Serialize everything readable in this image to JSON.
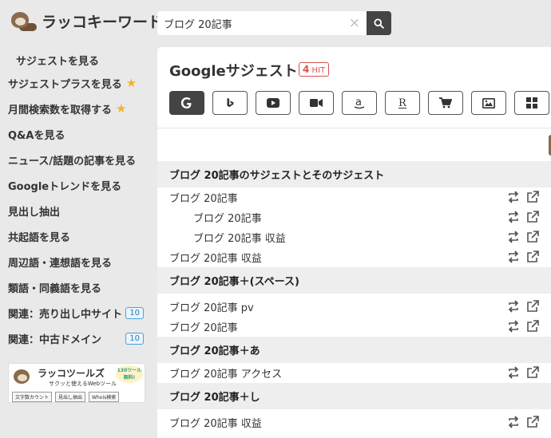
{
  "header": {
    "logo_text": "ラッコキーワード",
    "search_value": "ブログ 20記事",
    "clear_symbol": "×"
  },
  "sidebar": {
    "items": [
      {
        "label": "サジェストを見る"
      },
      {
        "label": "サジェストプラスを見る",
        "star": "★"
      },
      {
        "label": "月間検索数を取得する",
        "star": "★"
      },
      {
        "label": "Q&Aを見る"
      },
      {
        "label": "ニュース/話題の記事を見る"
      },
      {
        "label": "Googleトレンドを見る"
      },
      {
        "label": "見出し抽出"
      },
      {
        "label": "共起語を見る"
      },
      {
        "label": "周辺語・連想語を見る"
      },
      {
        "label": "類語・同義語を見る"
      },
      {
        "label": "関連：売り出し中サイト",
        "badge": "10"
      },
      {
        "label": "関連：中古ドメイン",
        "badge": "10"
      }
    ],
    "ad": {
      "title": "ラッコツールズ",
      "subtitle": "サクッと使えるWebツール",
      "free_line1": "130ツール",
      "free_line2": "無料!",
      "tags": [
        "文字数カウント",
        "見出し抽出",
        "Whois検索"
      ]
    }
  },
  "main": {
    "title": "Googleサジェスト",
    "hit_count": "4",
    "hit_label": "HIT",
    "engines": [
      "google-icon",
      "bing-icon",
      "youtube-icon",
      "video-icon",
      "amazon-icon",
      "rakuten-icon",
      "cart-icon",
      "image-icon",
      "grid-icon"
    ],
    "sections": [
      {
        "heading": "ブログ 20記事のサジェストとそのサジェスト",
        "rows": [
          {
            "text": "ブログ 20記事",
            "indent": false
          },
          {
            "text": "ブログ 20記事",
            "indent": true
          },
          {
            "text": "ブログ 20記事 収益",
            "indent": true
          },
          {
            "text": "ブログ 20記事 収益",
            "indent": false
          }
        ]
      },
      {
        "heading": "ブログ 20記事＋(スペース)",
        "rows": [
          {
            "text": "ブログ 20記事 pv",
            "indent": false
          },
          {
            "text": "ブログ 20記事",
            "indent": false
          }
        ]
      },
      {
        "heading": "ブログ 20記事＋あ",
        "rows": [
          {
            "text": "ブログ 20記事 アクセス",
            "indent": false
          }
        ]
      },
      {
        "heading": "ブログ 20記事＋し",
        "rows": [
          {
            "text": "ブログ 20記事 収益",
            "indent": false
          }
        ]
      }
    ]
  },
  "colors": {
    "background": "#e9e9e9",
    "accent_dark": "#444444",
    "hit_red": "#d9534f",
    "star": "#f0b429",
    "badge_blue": "#2b7bbf"
  }
}
